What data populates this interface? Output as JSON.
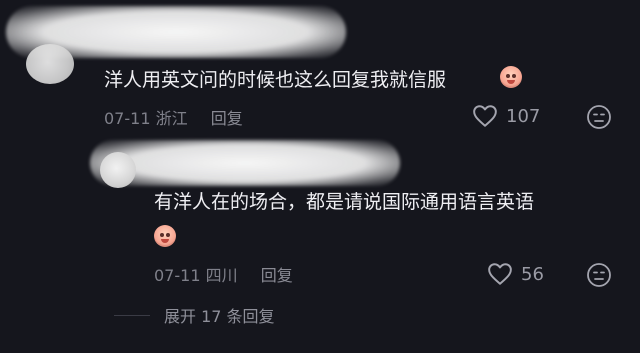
{
  "comments": [
    {
      "text": "洋人用英文问的时候也这么回复我就信服",
      "date": "07-11",
      "location": "浙江",
      "reply_label": "回复",
      "likes": "107",
      "emoji": "emoji-face"
    },
    {
      "text": "有洋人在的场合，都是请说国际通用语言英语",
      "date": "07-11",
      "location": "四川",
      "reply_label": "回复",
      "likes": "56",
      "emoji": "emoji-face"
    }
  ],
  "expand_replies": "展开 17 条回复",
  "colors": {
    "background": "#15161d",
    "primary_text": "#eeeef2",
    "secondary_text": "#7f808a"
  }
}
